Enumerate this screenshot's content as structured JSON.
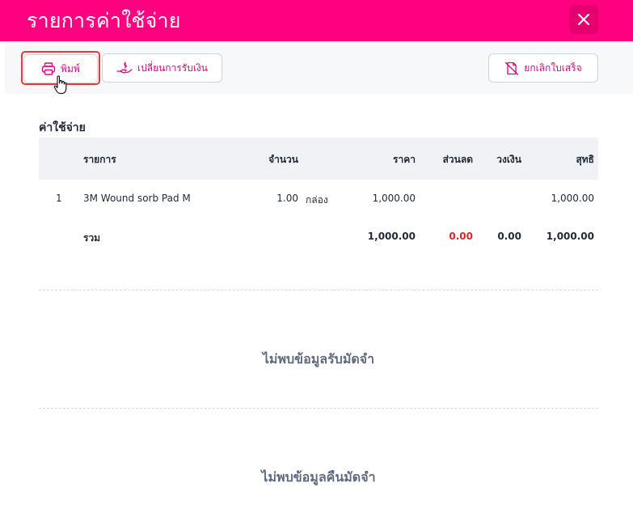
{
  "header": {
    "title": "รายการค่าใช้จ่าย"
  },
  "toolbar": {
    "print_label": "พิมพ์",
    "change_payment_label": "เปลี่ยนการรับเงิน",
    "cancel_receipt_label": "ยกเลิกใบเสร็จ"
  },
  "expenses": {
    "title": "ค่าใช้จ่าย",
    "columns": [
      "รายการ",
      "จำนวน",
      "ราคา",
      "ส่วนลด",
      "วงเงิน",
      "สุทธิ"
    ],
    "rows": [
      {
        "no": "1",
        "item": "3M Wound sorb Pad M",
        "qty": "1.00",
        "unit": "กล่อง",
        "price": "1,000.00",
        "discount": "",
        "limit": "",
        "net": "1,000.00"
      }
    ],
    "total": {
      "label": "รวม",
      "price": "1,000.00",
      "discount": "0.00",
      "limit": "0.00",
      "net": "1,000.00"
    }
  },
  "deposit": {
    "empty_text": "ไม่พบข้อมูลรับมัดจำ"
  },
  "refund": {
    "empty_text": "ไม่พบข้อมูลคืนมัดจำ"
  },
  "colors": {
    "brand": "#ff0080",
    "accent": "#e6007a",
    "discount_red": "#e02424"
  }
}
